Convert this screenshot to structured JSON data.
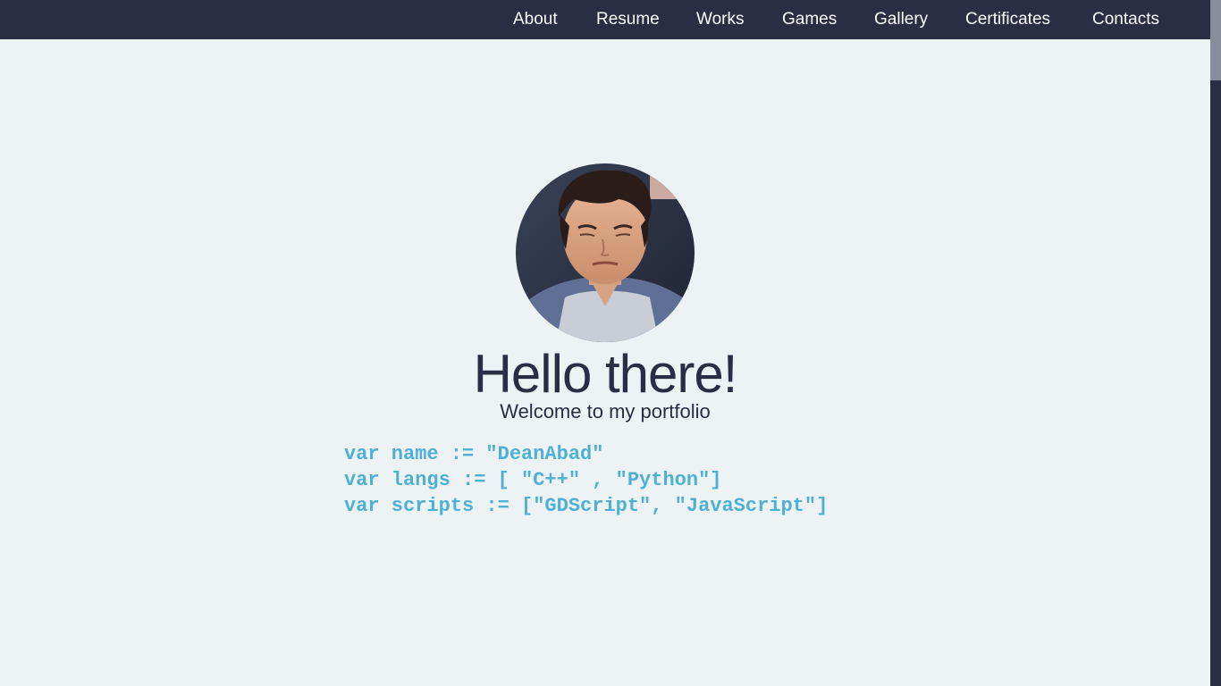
{
  "nav": {
    "items": [
      "About",
      "Resume",
      "Works",
      "Games",
      "Gallery",
      "Certificates",
      "Contacts"
    ]
  },
  "hero": {
    "avatar_icon": "profile-photo",
    "title": "Hello there!",
    "subtitle": "Welcome to my portfolio"
  },
  "code": {
    "lines": [
      "var name := \"DeanAbad\"",
      "var langs := [ \"C++\" , \"Python\"]",
      "var scripts := [\"GDScript\", \"JavaScript\"]"
    ]
  },
  "colors": {
    "navbar": "#2a2d44",
    "background": "#edf2f5",
    "heading": "#2a2d44",
    "code": "#4fb0d6"
  }
}
